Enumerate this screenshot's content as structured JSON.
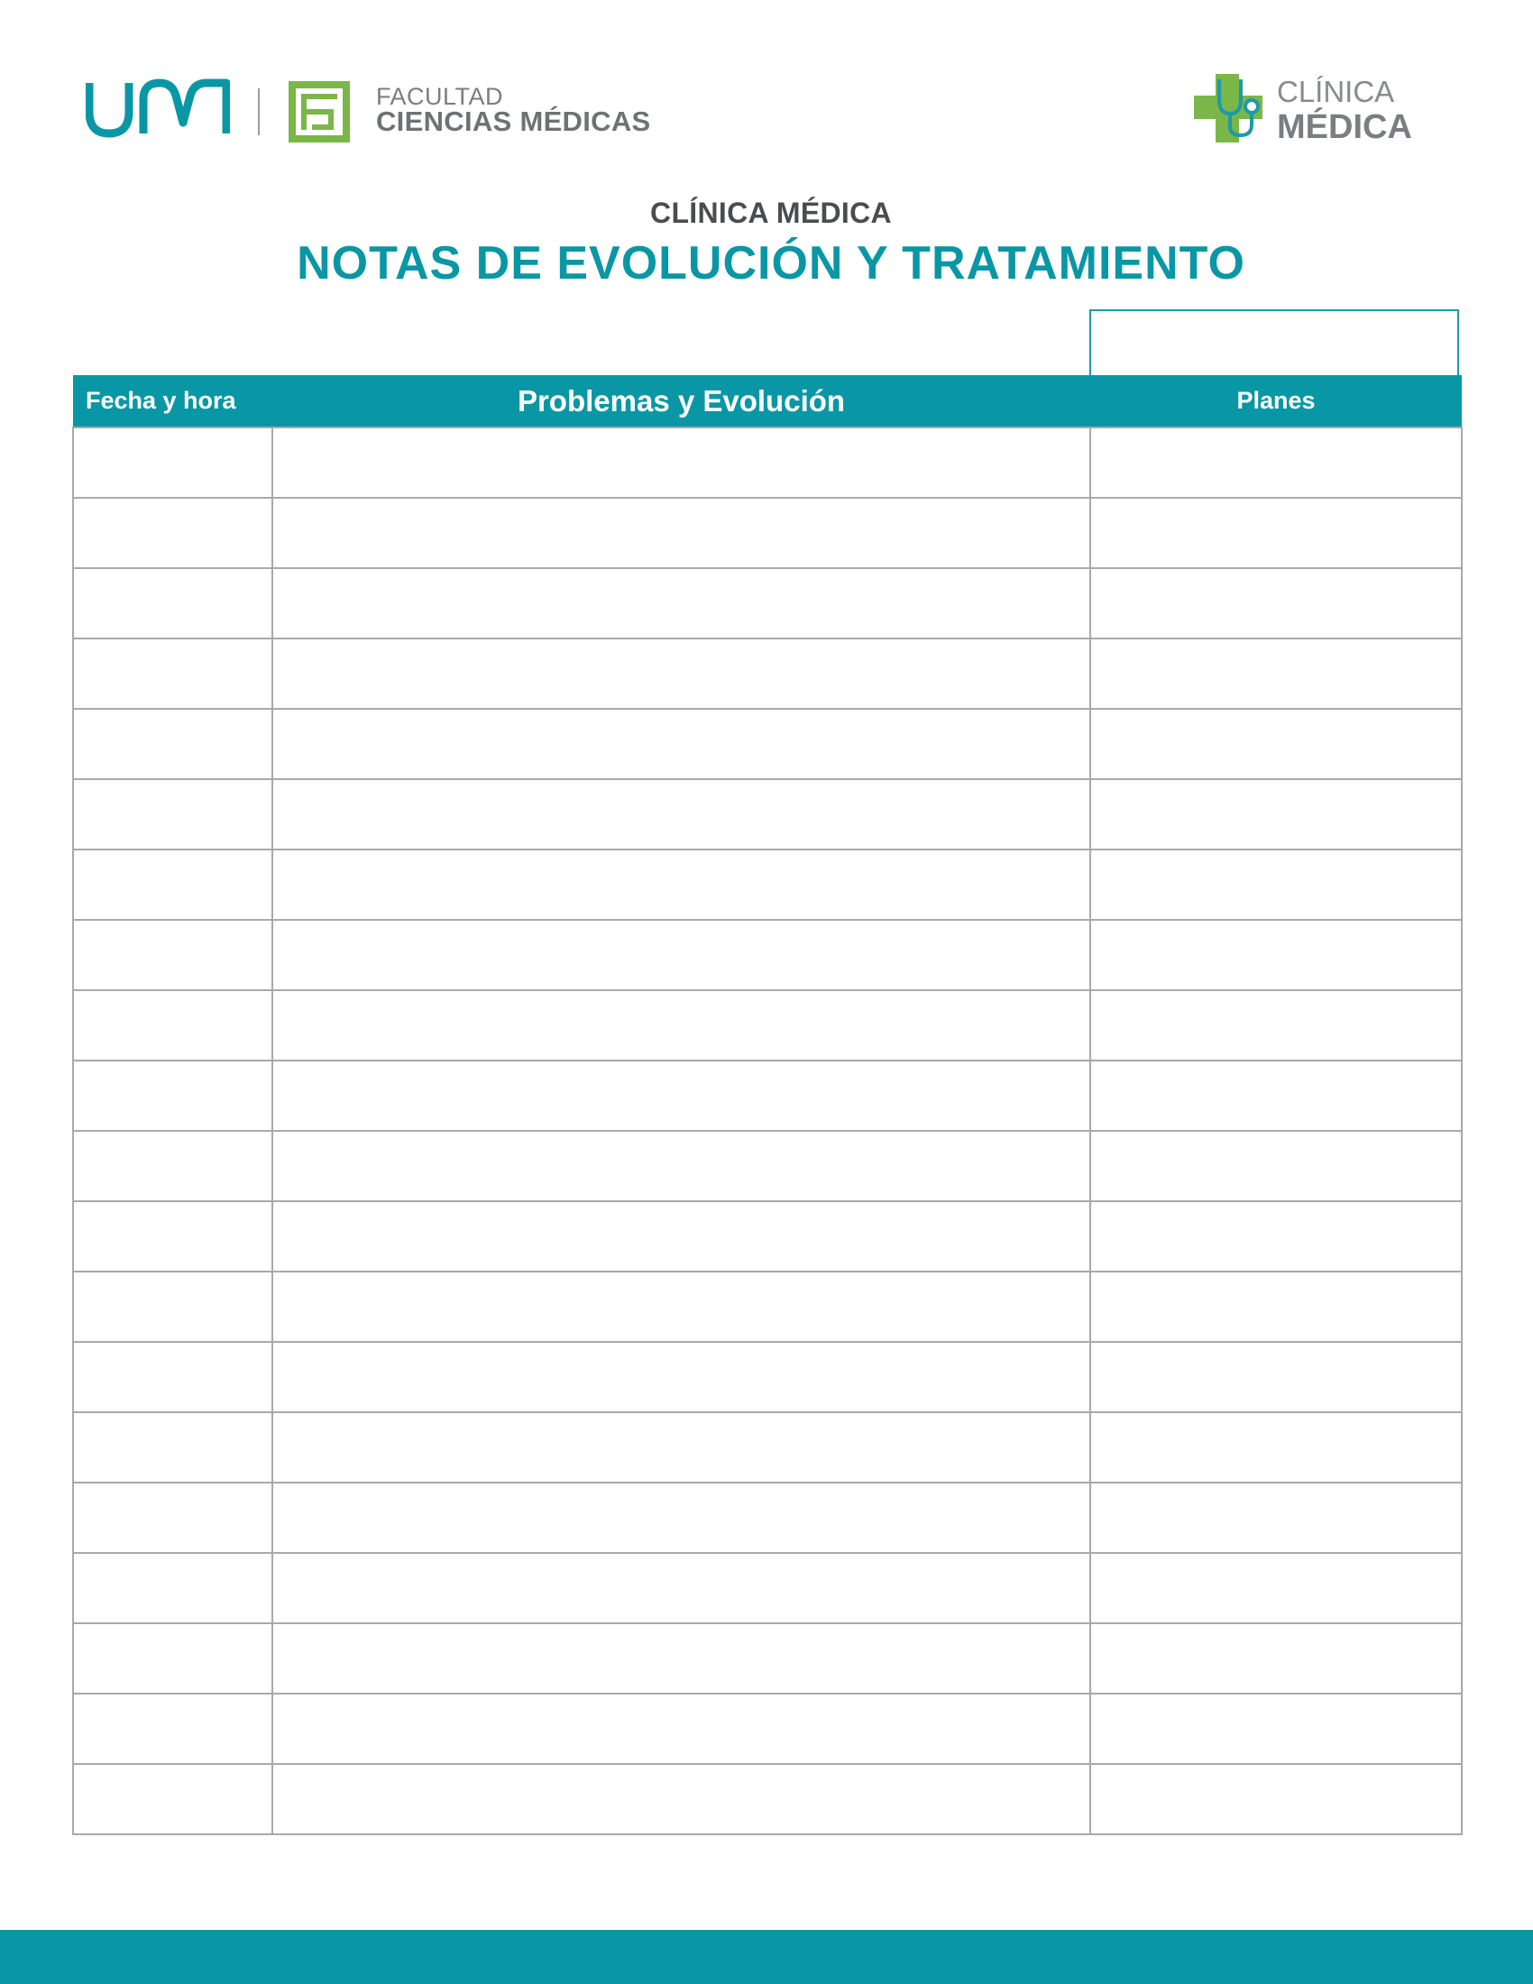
{
  "header": {
    "uam_logo_text": "UAM",
    "faculty": {
      "line1": "FACULTAD",
      "line2": "CIENCIAS MÉDICAS"
    },
    "clinic": {
      "line1": "CLÍNICA",
      "line2": "MÉDICA"
    }
  },
  "document": {
    "subtitle": "CLÍNICA MÉDICA",
    "title": "NOTAS DE EVOLUCIÓN Y TRATAMIENTO"
  },
  "table": {
    "columns": [
      "Fecha y hora",
      "Problemas y Evolución",
      "Planes"
    ],
    "row_count": 20
  },
  "colors": {
    "accent_teal": "#0a97a5",
    "logo_green": "#7ab648",
    "text_gray": "#6f7275",
    "grid_gray": "#a7a9ab"
  }
}
